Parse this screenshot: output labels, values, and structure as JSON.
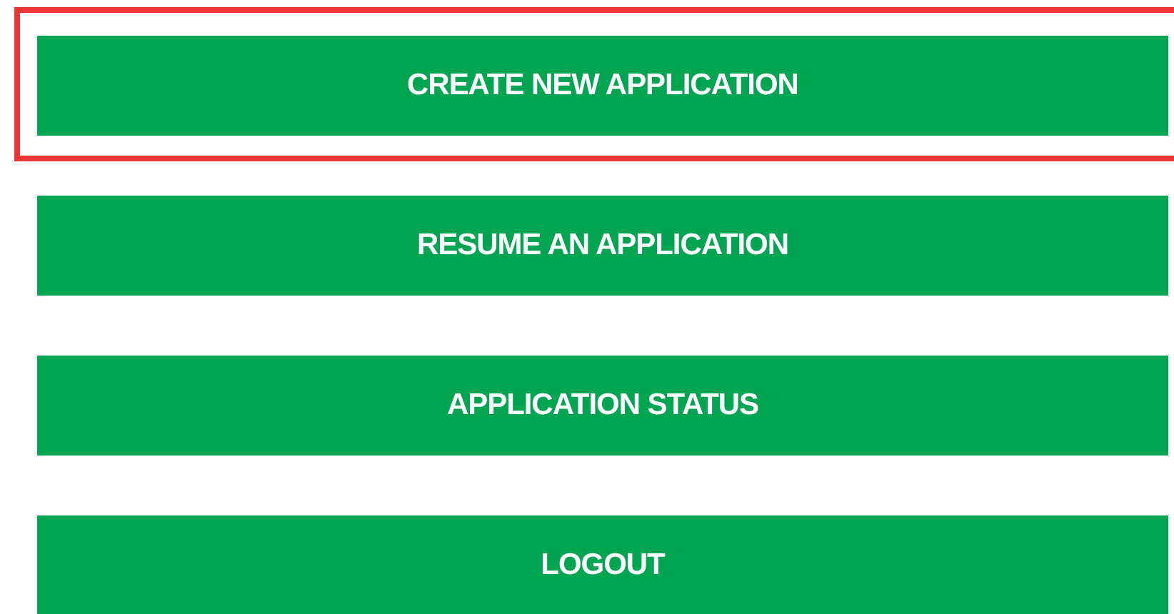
{
  "buttons": [
    {
      "label": "CREATE NEW APPLICATION",
      "highlighted": true
    },
    {
      "label": "RESUME AN APPLICATION",
      "highlighted": false
    },
    {
      "label": "APPLICATION STATUS",
      "highlighted": false
    },
    {
      "label": "LOGOUT",
      "highlighted": false
    }
  ]
}
